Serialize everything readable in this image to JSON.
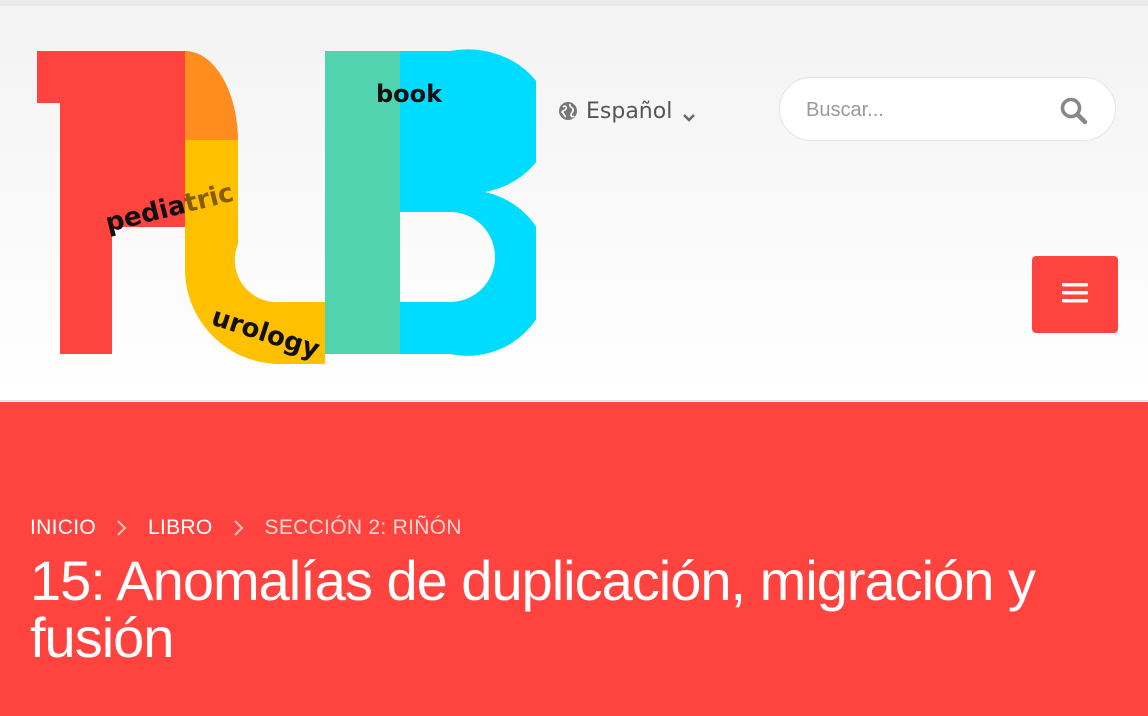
{
  "logo": {
    "letters": "PUB",
    "words": {
      "pediatric_part1": "pedia",
      "pediatric_part2": "tric",
      "urology": "urology",
      "book": "book"
    },
    "colors": {
      "p_red": "#ff433f",
      "p_orange": "#ff8c1f",
      "u_yellow": "#ffc000",
      "u_green": "#52d3b0",
      "b_cyan": "#00dcff"
    }
  },
  "language": {
    "label": "Español",
    "icon": "globe-icon",
    "dropdown_icon": "chevron-down-icon"
  },
  "search": {
    "placeholder": "Buscar...",
    "value": "",
    "icon": "search-icon"
  },
  "menu": {
    "icon": "hamburger-menu-icon"
  },
  "breadcrumb": {
    "items": [
      "INICIO",
      "LIBRO",
      "SECCIÓN 2: RIÑÓN"
    ],
    "separator_icon": "chevron-right-icon"
  },
  "page": {
    "title": "15: Anomalías de duplicación, migración y fusión"
  },
  "colors": {
    "accent": "#ff433f",
    "header_bg": "#f5f5f5"
  }
}
